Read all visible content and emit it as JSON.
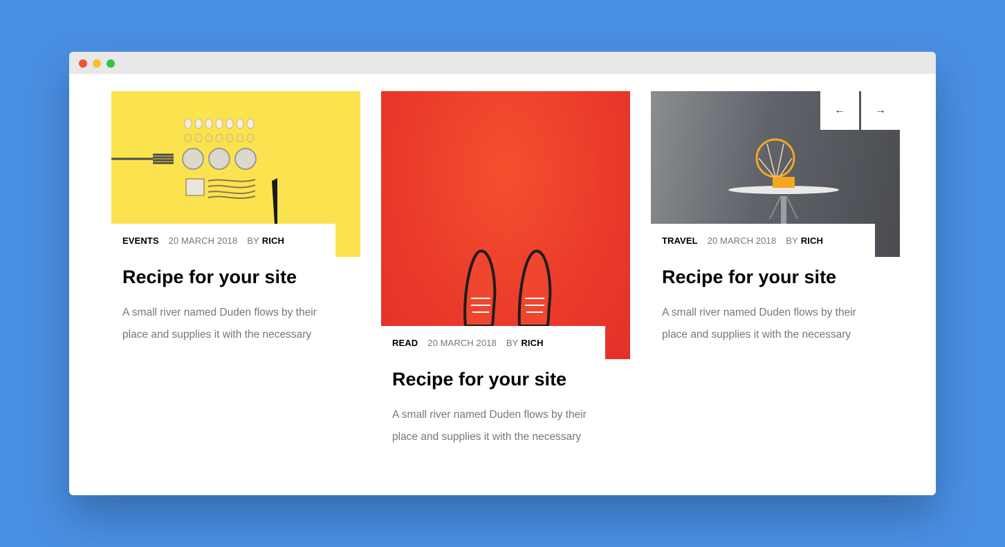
{
  "posts": [
    {
      "category": "EVENTS",
      "date": "20 MARCH 2018",
      "by": "BY",
      "author": "RICH",
      "title": "Recipe for your site",
      "excerpt": "A small river named Duden flows by their place and supplies it with the necessary"
    },
    {
      "category": "READ",
      "date": "20 MARCH 2018",
      "by": "BY",
      "author": "RICH",
      "title": "Recipe for your site",
      "excerpt": "A small river named Duden flows by their place and supplies it with the necessary"
    },
    {
      "category": "TRAVEL",
      "date": "20 MARCH 2018",
      "by": "BY",
      "author": "RICH",
      "title": "Recipe for your site",
      "excerpt": "A small river named Duden flows by their place and supplies it with the necessary"
    }
  ],
  "carousel": {
    "prev_icon": "arrow-left-icon",
    "next_icon": "arrow-right-icon",
    "prev_glyph": "←",
    "next_glyph": "→"
  },
  "colors": {
    "background": "#4a90e2",
    "card1_image": "#fbe34f",
    "card2_image": "#ea3a2a",
    "card3_image": "#5a5d63"
  }
}
